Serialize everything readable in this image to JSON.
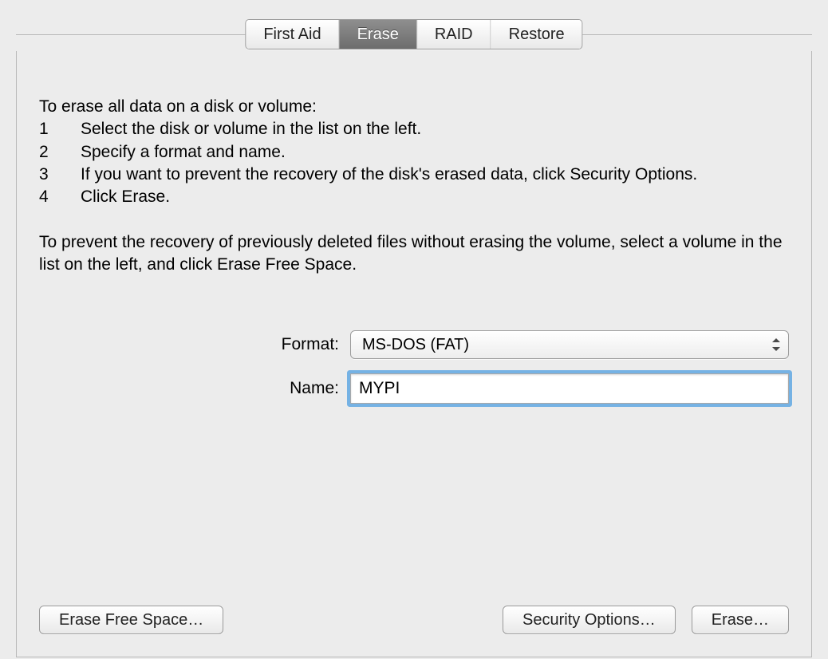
{
  "tabs": {
    "first_aid": "First Aid",
    "erase": "Erase",
    "raid": "RAID",
    "restore": "Restore"
  },
  "instructions": {
    "heading": "To erase all data on a disk or volume:",
    "steps": [
      {
        "n": "1",
        "text": "Select the disk or volume in the list on the left."
      },
      {
        "n": "2",
        "text": "Specify a format and name."
      },
      {
        "n": "3",
        "text": "If you want to prevent the recovery of the disk's erased data, click Security Options."
      },
      {
        "n": "4",
        "text": "Click Erase."
      }
    ],
    "footer": "To prevent the recovery of previously deleted files without erasing the volume, select a volume in the list on the left, and click Erase Free Space."
  },
  "form": {
    "format_label": "Format:",
    "format_value": "MS-DOS (FAT)",
    "name_label": "Name:",
    "name_value": "MYPI"
  },
  "buttons": {
    "erase_free_space": "Erase Free Space…",
    "security_options": "Security Options…",
    "erase": "Erase…"
  }
}
